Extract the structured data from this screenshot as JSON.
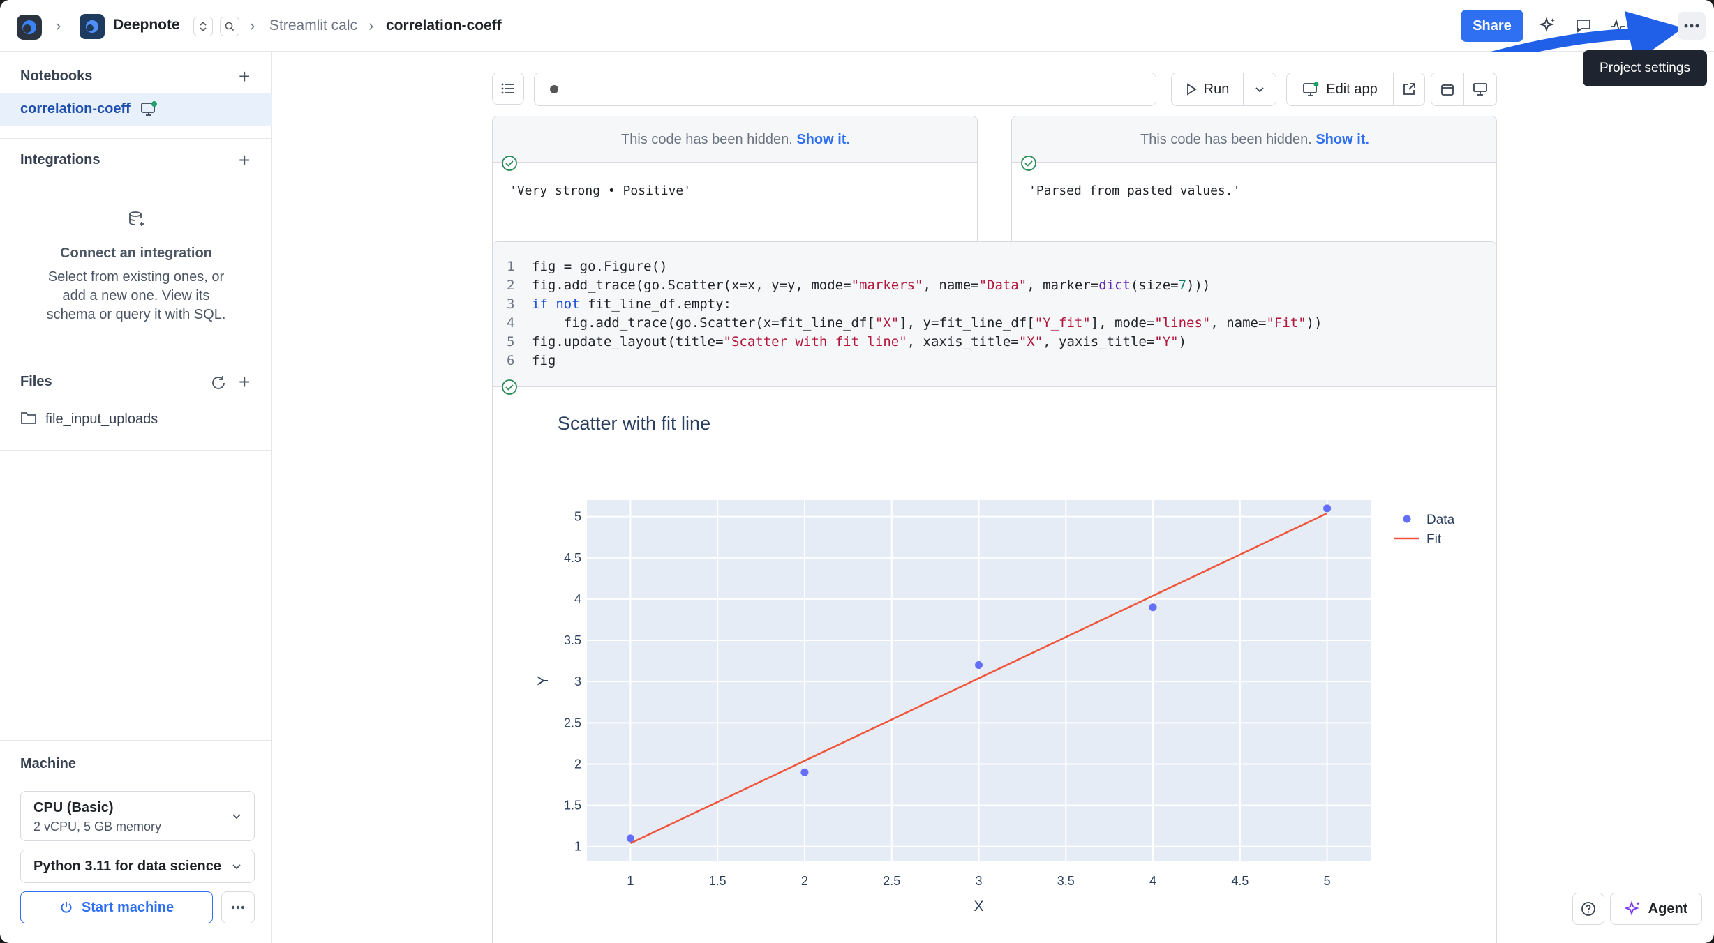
{
  "topbar": {
    "workspace": "Deepnote",
    "project": "Streamlit calc",
    "notebook": "correlation-coeff",
    "share_label": "Share",
    "tooltip": "Project settings"
  },
  "sidebar": {
    "notebooks_title": "Notebooks",
    "notebook_item": "correlation-coeff",
    "integrations_title": "Integrations",
    "connect_title": "Connect an integration",
    "connect_desc_1": "Select from existing ones, or",
    "connect_desc_2": "add a new one. View its",
    "connect_desc_3": "schema or query it with SQL.",
    "files_title": "Files",
    "folder": "file_input_uploads",
    "machine_title": "Machine",
    "machine_name": "CPU (Basic)",
    "machine_spec": "2 vCPU, 5 GB memory",
    "env": "Python 3.11 for data science",
    "start_label": "Start machine"
  },
  "toolbar": {
    "run_label": "Run",
    "edit_app_label": "Edit app"
  },
  "hidden_cells": [
    {
      "hidden_text": "This code has been hidden.",
      "show_link": "Show it.",
      "output": "'Very strong • Positive'"
    },
    {
      "hidden_text": "This code has been hidden.",
      "show_link": "Show it.",
      "output": "'Parsed from pasted values.'"
    }
  ],
  "code": {
    "line_numbers": [
      "1",
      "2",
      "3",
      "4",
      "5",
      "6"
    ],
    "lines": [
      "fig = go.Figure()",
      "fig.add_trace(go.Scatter(x=x, y=y, mode=\"markers\", name=\"Data\", marker=dict(size=7)))",
      "if not fit_line_df.empty:",
      "    fig.add_trace(go.Scatter(x=fit_line_df[\"X\"], y=fit_line_df[\"Y_fit\"], mode=\"lines\", name=\"Fit\"))",
      "fig.update_layout(title=\"Scatter with fit line\", xaxis_title=\"X\", yaxis_title=\"Y\")",
      "fig"
    ]
  },
  "footer": {
    "agent_label": "Agent"
  },
  "colors": {
    "accent": "#2f6ff1",
    "data_marker": "#636efa",
    "fit_line": "#ef553b",
    "plot_bg": "#e5ecf6"
  },
  "chart_data": {
    "type": "scatter",
    "title": "Scatter with fit line",
    "xlabel": "X",
    "ylabel": "Y",
    "xlim": [
      0.75,
      5.25
    ],
    "ylim": [
      0.82,
      5.2
    ],
    "x_ticks": [
      1,
      1.5,
      2,
      2.5,
      3,
      3.5,
      4,
      4.5,
      5
    ],
    "x_tick_labels": [
      "1",
      "1.5",
      "2",
      "2.5",
      "3",
      "3.5",
      "4",
      "4.5",
      "5"
    ],
    "y_ticks": [
      1,
      1.5,
      2,
      2.5,
      3,
      3.5,
      4,
      4.5,
      5
    ],
    "y_tick_labels": [
      "1",
      "1.5",
      "2",
      "2.5",
      "3",
      "3.5",
      "4",
      "4.5",
      "5"
    ],
    "grid": true,
    "legend_position": "top-right",
    "series": [
      {
        "name": "Data",
        "mode": "markers",
        "x": [
          1,
          2,
          3,
          4,
          5
        ],
        "y": [
          1.1,
          1.9,
          3.2,
          3.9,
          5.1
        ]
      },
      {
        "name": "Fit",
        "mode": "lines",
        "x": [
          1,
          5
        ],
        "y": [
          1.04,
          5.04
        ]
      }
    ]
  }
}
